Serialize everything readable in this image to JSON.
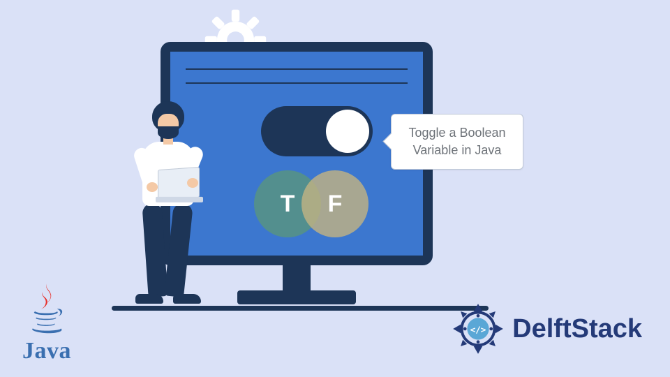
{
  "callout": {
    "line1": "Toggle a Boolean",
    "line2": "Variable in Java"
  },
  "venn": {
    "left": "T",
    "right": "F"
  },
  "logos": {
    "java": "Java",
    "delftstack": "DelftStack"
  },
  "colors": {
    "background": "#dae1f7",
    "monitor_frame": "#1d3557",
    "screen": "#3c77cf",
    "accent_blue": "#243a78"
  }
}
